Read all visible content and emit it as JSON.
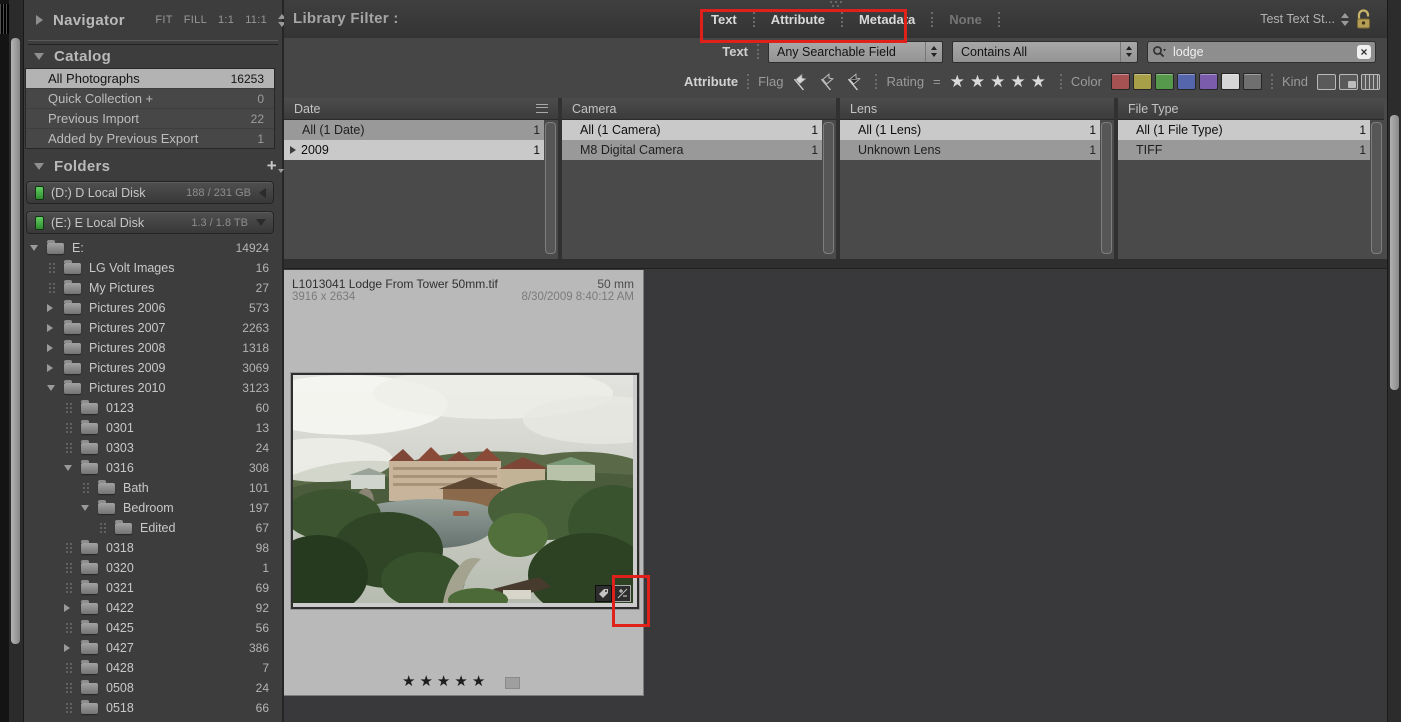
{
  "icons": {
    "star": "★",
    "close": "×",
    "equals": "="
  },
  "left_panel": {
    "navigator": {
      "title": "Navigator",
      "zoom_levels": [
        "FIT",
        "FILL",
        "1:1",
        "11:1"
      ]
    },
    "catalog": {
      "title": "Catalog",
      "items": [
        {
          "label": "All Photographs",
          "count": "16253"
        },
        {
          "label": "Quick Collection  +",
          "count": "0"
        },
        {
          "label": "Previous Import",
          "count": "22"
        },
        {
          "label": "Added by Previous Export",
          "count": "1"
        }
      ]
    },
    "folders": {
      "title": "Folders",
      "volumes": [
        {
          "label": "(D:) D Local Disk",
          "capacity": "188 / 231 GB"
        },
        {
          "label": "(E:) E Local Disk",
          "capacity": "1.3 / 1.8 TB"
        }
      ],
      "tree": [
        {
          "label": "E:",
          "count": "14924"
        },
        {
          "label": "LG Volt Images",
          "count": "16"
        },
        {
          "label": "My Pictures",
          "count": "27"
        },
        {
          "label": "Pictures 2006",
          "count": "573"
        },
        {
          "label": "Pictures 2007",
          "count": "2263"
        },
        {
          "label": "Pictures 2008",
          "count": "1318"
        },
        {
          "label": "Pictures 2009",
          "count": "3069"
        },
        {
          "label": "Pictures 2010",
          "count": "3123"
        },
        {
          "label": "0123",
          "count": "60"
        },
        {
          "label": "0301",
          "count": "13"
        },
        {
          "label": "0303",
          "count": "24"
        },
        {
          "label": "0316",
          "count": "308"
        },
        {
          "label": "Bath",
          "count": "101"
        },
        {
          "label": "Bedroom",
          "count": "197"
        },
        {
          "label": "Edited",
          "count": "67"
        },
        {
          "label": "0318",
          "count": "98"
        },
        {
          "label": "0320",
          "count": "1"
        },
        {
          "label": "0321",
          "count": "69"
        },
        {
          "label": "0422",
          "count": "92"
        },
        {
          "label": "0425",
          "count": "56"
        },
        {
          "label": "0427",
          "count": "386"
        },
        {
          "label": "0428",
          "count": "7"
        },
        {
          "label": "0508",
          "count": "24"
        },
        {
          "label": "0518",
          "count": "66"
        }
      ]
    }
  },
  "filter_bar": {
    "label": "Library Filter :",
    "tabs": [
      "Text",
      "Attribute",
      "Metadata",
      "None"
    ],
    "preset": "Test Text St..."
  },
  "text_filter": {
    "label": "Text",
    "field": "Any Searchable Field",
    "rule": "Contains All",
    "query": "lodge"
  },
  "attribute_filter": {
    "label": "Attribute",
    "flag_label": "Flag",
    "rating_label": "Rating",
    "rating_op": "=",
    "color_label": "Color",
    "kind_label": "Kind",
    "colors": [
      "#a65252",
      "#a89f49",
      "#57994c",
      "#5566ac",
      "#7a5bac",
      "#d6d6d6",
      "#6f6f6f"
    ]
  },
  "metadata_browser": {
    "columns": [
      {
        "header": "Date",
        "rows": [
          {
            "label": "All (1 Date)",
            "count": "1"
          },
          {
            "label": "2009",
            "count": "1"
          }
        ]
      },
      {
        "header": "Camera",
        "rows": [
          {
            "label": "All (1 Camera)",
            "count": "1"
          },
          {
            "label": "M8 Digital Camera",
            "count": "1"
          }
        ]
      },
      {
        "header": "Lens",
        "rows": [
          {
            "label": "All (1 Lens)",
            "count": "1"
          },
          {
            "label": "Unknown Lens",
            "count": "1"
          }
        ]
      },
      {
        "header": "File Type",
        "rows": [
          {
            "label": "All (1 File Type)",
            "count": "1"
          },
          {
            "label": "TIFF",
            "count": "1"
          }
        ]
      }
    ]
  },
  "photo_cell": {
    "filename": "L1013041 Lodge From Tower 50mm.tif",
    "dimensions": "3916 x 2634",
    "focal_length": "50 mm",
    "capture_time": "8/30/2009 8:40:12 AM"
  }
}
